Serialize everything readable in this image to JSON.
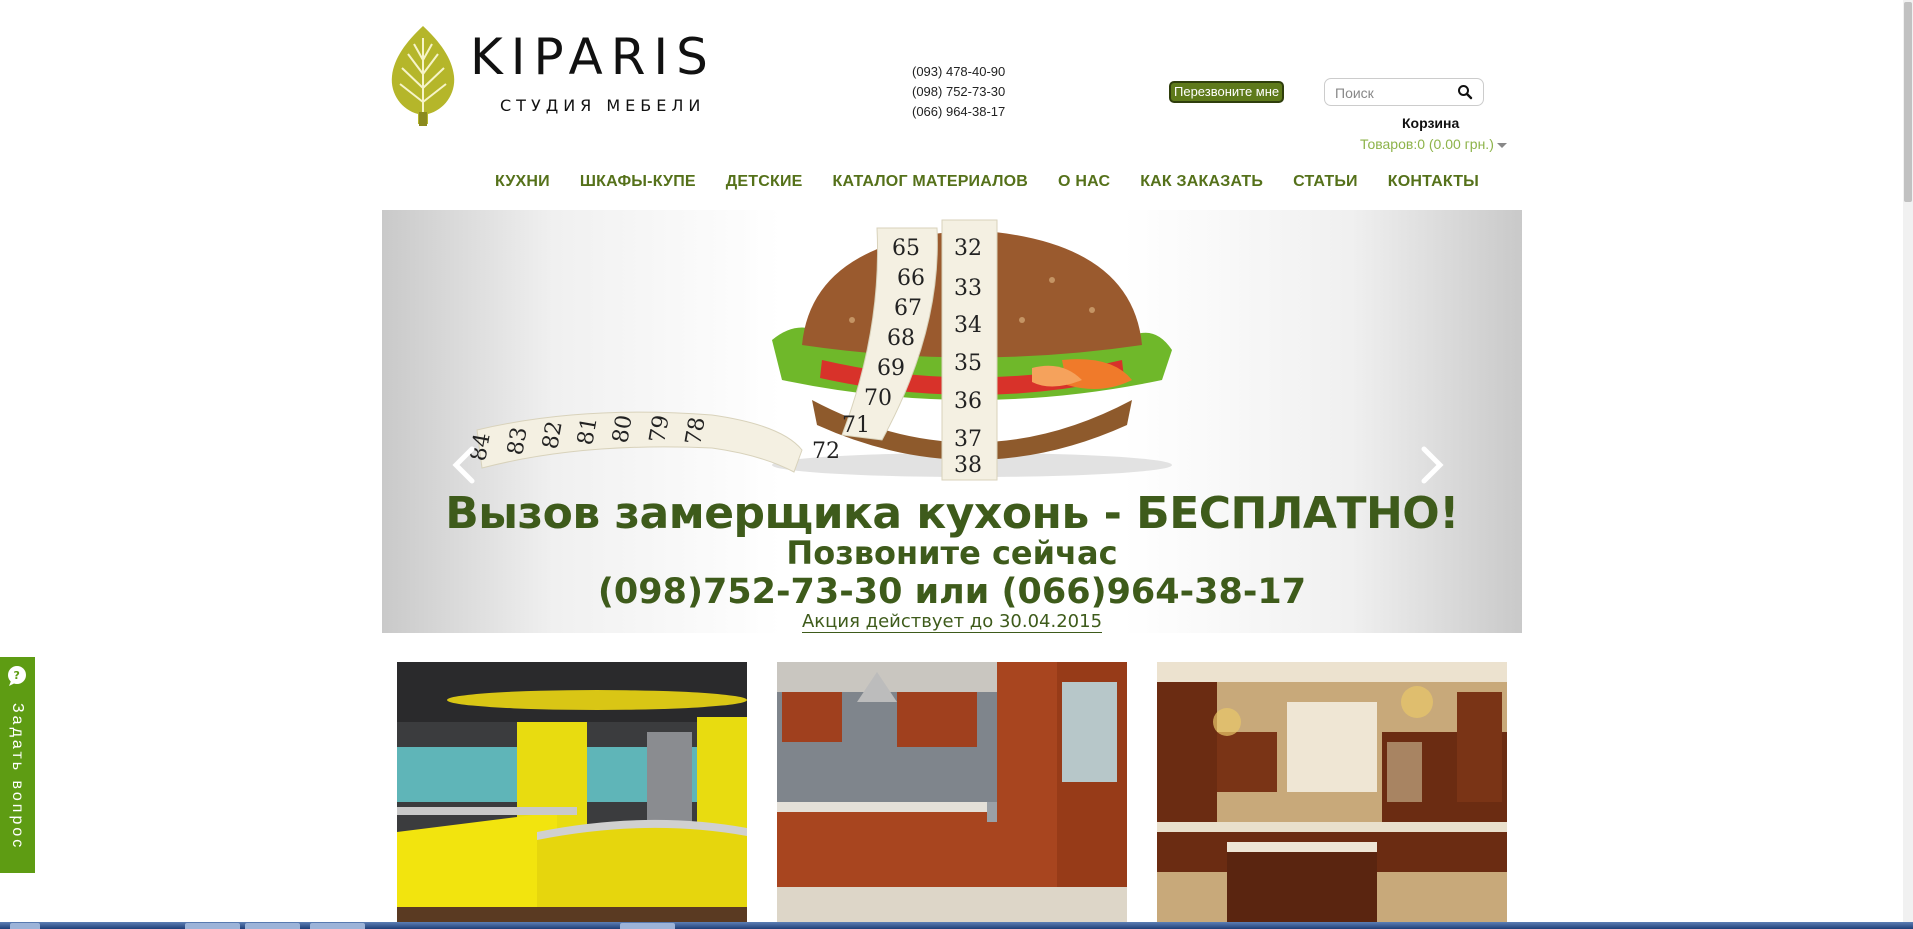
{
  "brand": {
    "name": "KIPARIS",
    "subtitle": "СТУДИЯ МЕБЕЛИ"
  },
  "header": {
    "phones": [
      "(093) 478-40-90",
      "(098) 752-73-30",
      "(066) 964-38-17"
    ],
    "callback_label": "Перезвоните мне",
    "search_placeholder": "Поиск",
    "cart_title": "Корзина",
    "cart_info": "Товаров:0 (0.00 грн.)"
  },
  "nav": {
    "items": [
      "КУХНИ",
      "ШКАФЫ-КУПЕ",
      "ДЕТСКИЕ",
      "КАТАЛОГ МАТЕРИАЛОВ",
      "О НАС",
      "КАК ЗАКАЗАТЬ",
      "СТАТЬИ",
      "КОНТАКТЫ"
    ]
  },
  "slider": {
    "headline": "Вызов замерщика кухонь - БЕСПЛАТНО!",
    "line2": "Позвоните сейчас",
    "line3": "(098)752-73-30 или (066)964-38-17",
    "note": "Акция действует до 30.04.2015",
    "tape_numbers_left": [
      "84",
      "83",
      "82",
      "81",
      "80",
      "79",
      "78"
    ],
    "tape_numbers_center": [
      "65",
      "66",
      "67",
      "68",
      "69",
      "70",
      "71",
      "72"
    ],
    "tape_numbers_right": [
      "32",
      "33",
      "34",
      "35",
      "36",
      "37",
      "38"
    ]
  },
  "tiles": [
    {
      "image": "yellow-kitchen"
    },
    {
      "image": "cherry-corner-kitchen"
    },
    {
      "image": "classic-wood-kitchen"
    }
  ],
  "ask_widget": {
    "label": "Задать вопрос"
  },
  "colors": {
    "accent_green": "#55711a",
    "headline_green": "#3e5b1b",
    "cart_green": "#8db34a",
    "callback_bg": "#5e7a1b",
    "ask_bg": "#5e9c13"
  }
}
